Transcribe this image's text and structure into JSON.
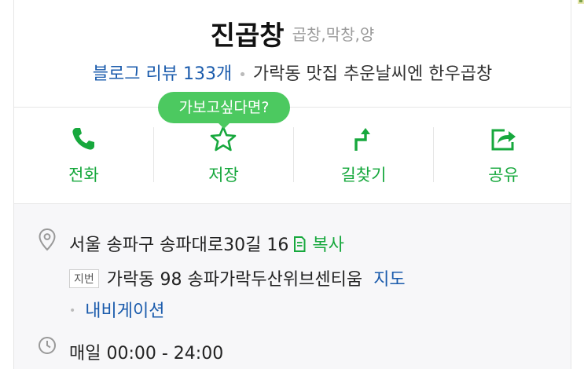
{
  "place": {
    "name": "진곱창",
    "category": "곱창,막창,양",
    "review_link": "블로그 리뷰 133개",
    "tagline": "가락동 맛집 추운날씨엔 한우곱창"
  },
  "tooltip": "가보고싶다면?",
  "actions": [
    {
      "label": "전화",
      "icon": "phone-icon"
    },
    {
      "label": "저장",
      "icon": "star-icon"
    },
    {
      "label": "길찾기",
      "icon": "directions-icon"
    },
    {
      "label": "공유",
      "icon": "share-icon"
    }
  ],
  "info": {
    "address": "서울 송파구 송파대로30길 16",
    "copy_label": "복사",
    "jibeon_badge": "지번",
    "jibeon_address": "가락동 98 송파가락두산위브센티움",
    "map_link": "지도",
    "navigation_link": "내비게이션",
    "hours": "매일 00:00 - 24:00"
  },
  "colors": {
    "accent_green": "#17a83d",
    "tooltip_green": "#4cc960",
    "link_blue": "#1a5bac"
  }
}
